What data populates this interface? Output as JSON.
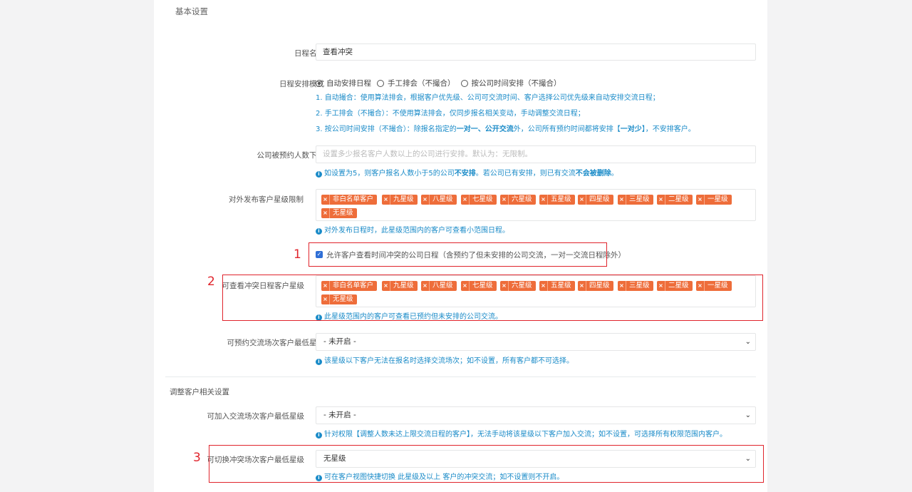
{
  "basic_section_title": "基本设置",
  "schedule_name": {
    "label": "日程名称",
    "value": "查看冲突"
  },
  "schedule_mode": {
    "label": "日程安排模式",
    "options": [
      "自动安排日程",
      "手工排会（不撮合）",
      "按公司时间安排（不撮合）"
    ],
    "selected": "自动安排日程",
    "help1": "1. 自动撮合：使用算法排会，根据客户优先级、公司可交流时间、客户选择公司优先级来自动安排交流日程；",
    "help2": "2. 手工排会（不撮合）：不使用算法排会，仅同步报名相关变动，手动调整交流日程；",
    "help3_a": "3. 按公司时间安排（不撮合）：除报名指定的",
    "help3_b": "一对一、公开交流",
    "help3_c": "外，公司所有预约时间都将安排【",
    "help3_d": "一对少",
    "help3_e": "】，不安排客户。"
  },
  "min_booking": {
    "label": "公司被预约人数下限",
    "placeholder": "设置多少报名客户人数以上的公司进行安排。默认为：无限制。",
    "help_a": "如设置为5，则客户报名人数小于5的公司",
    "help_b": "不安排",
    "help_c": "。若公司已有安排，则已有交流",
    "help_d": "不会被删除",
    "help_e": "。"
  },
  "external_level": {
    "label": "对外发布客户星级限制",
    "tags": [
      "非白名单客户",
      "九星级",
      "八星级",
      "七星级",
      "六星级",
      "五星级",
      "四星级",
      "三星级",
      "二星级",
      "一星级",
      "无星级"
    ],
    "help": "对外发布日程时，此星级范围内的客户可查看小范围日程。"
  },
  "allow_conflict": {
    "label": "允许客户查看时间冲突的公司日程（含预约了但未安排的公司交流，一对一交流日程除外）",
    "checked": true
  },
  "conflict_level": {
    "label": "可查看冲突日程客户星级",
    "tags": [
      "非白名单客户",
      "九星级",
      "八星级",
      "七星级",
      "六星级",
      "五星级",
      "四星级",
      "三星级",
      "二星级",
      "一星级",
      "无星级"
    ],
    "help": "此星级范围内的客户可查看已预约但未安排的公司交流。"
  },
  "min_session_level": {
    "label": "可预约交流场次客户最低星级",
    "value": "- 未开启 -",
    "help": "该星级以下客户无法在报名时选择交流场次；如不设置，所有客户都不可选择。"
  },
  "adjust_section_title": "调整客户相关设置",
  "join_level": {
    "label": "可加入交流场次客户最低星级",
    "value": "- 未开启 -",
    "help": "针对权限【调整人数未达上限交流日程的客户】，无法手动将该星级以下客户加入交流；如不设置，可选择所有权限范围内客户。"
  },
  "switch_level": {
    "label": "可切换冲突场次客户最低星级",
    "value": "无星级",
    "help": "可在客户视图快捷切换 此星级及以上 客户的冲突交流；如不设置则不开启。"
  },
  "annotations": [
    "1",
    "2",
    "3"
  ],
  "colors": {
    "tag": "#ee6d3a",
    "help": "#1a8bc8",
    "annotation": "#e0242c",
    "checkbox": "#2f6fd6"
  }
}
